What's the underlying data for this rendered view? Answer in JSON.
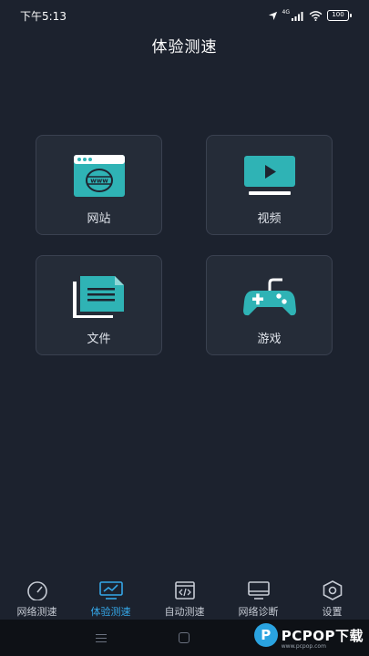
{
  "status_bar": {
    "time": "下午5:13",
    "network": "4G",
    "battery": "100"
  },
  "page": {
    "title": "体验测速"
  },
  "tiles": [
    {
      "label": "网站",
      "icon": "browser-www-icon"
    },
    {
      "label": "视频",
      "icon": "video-play-icon"
    },
    {
      "label": "文件",
      "icon": "document-icon"
    },
    {
      "label": "游戏",
      "icon": "gamepad-icon"
    }
  ],
  "tabs": [
    {
      "label": "网络测速",
      "icon": "speedometer-icon",
      "active": false
    },
    {
      "label": "体验测速",
      "icon": "monitor-chart-icon",
      "active": true
    },
    {
      "label": "自动测速",
      "icon": "code-window-icon",
      "active": false
    },
    {
      "label": "网络诊断",
      "icon": "monitor-icon",
      "active": false
    },
    {
      "label": "设置",
      "icon": "settings-hexagon-icon",
      "active": false
    }
  ],
  "colors": {
    "background": "#1c222e",
    "tile": "#252c38",
    "accent_teal": "#2fb3b5",
    "active_tab": "#35a7e8"
  },
  "watermark": {
    "logo": "P",
    "text": "PCPOP下载",
    "sub": "www.pcpop.com"
  }
}
